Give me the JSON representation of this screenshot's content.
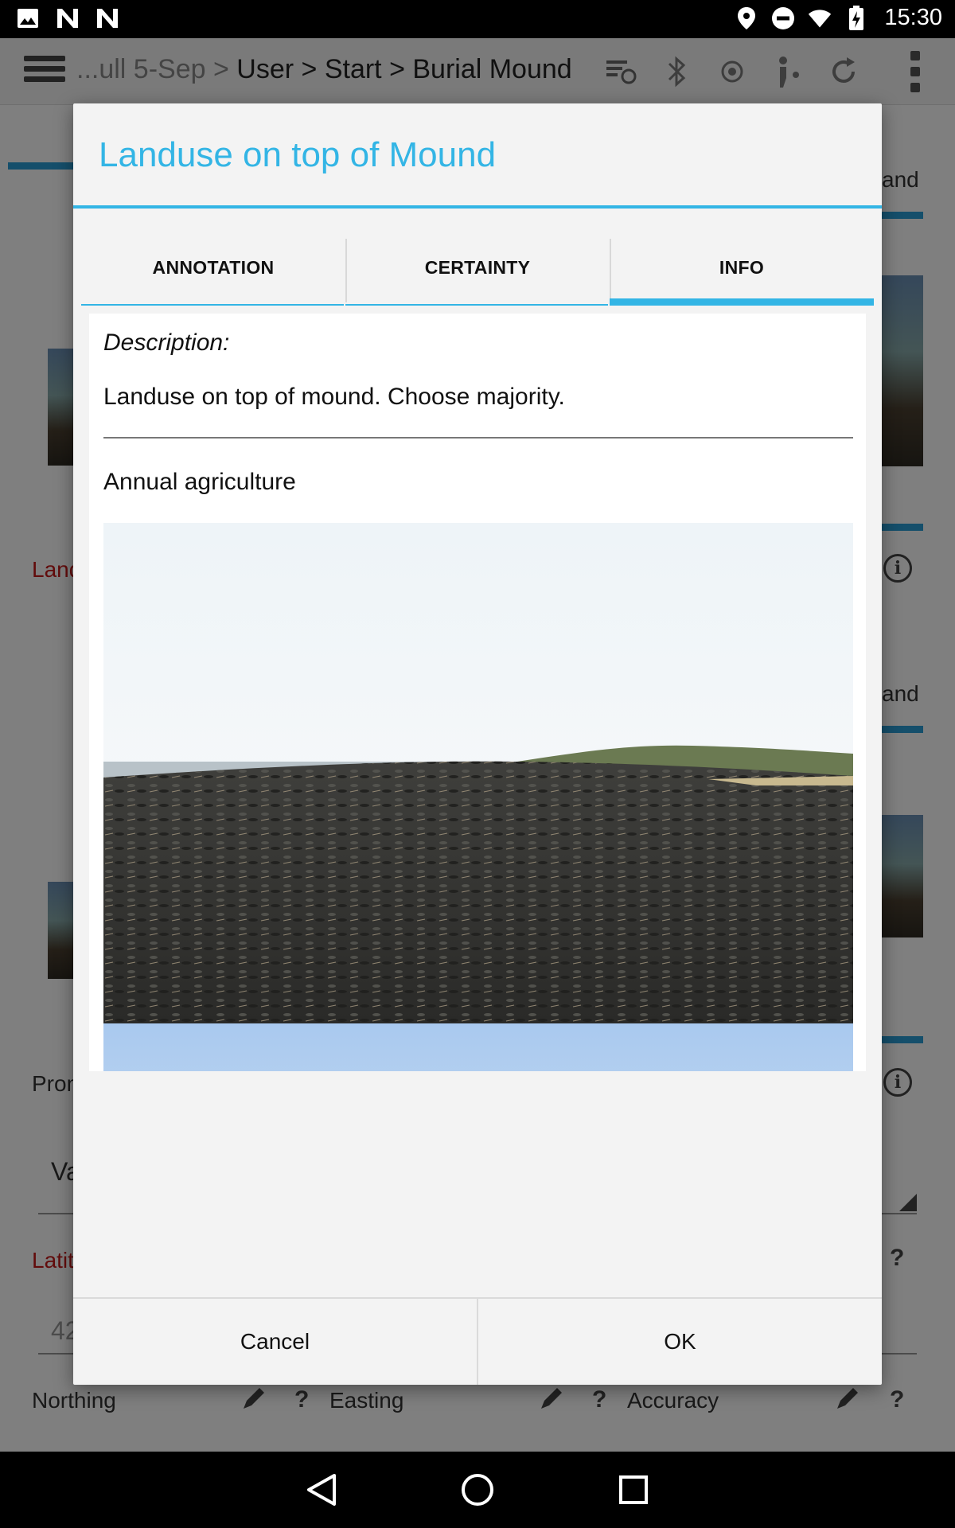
{
  "status_bar": {
    "time": "15:30",
    "icons": [
      "gallery-icon",
      "notification-n-icon",
      "notification-n-icon",
      "location-icon",
      "do-not-disturb-icon",
      "wifi-icon",
      "battery-charging-icon"
    ]
  },
  "app_bar": {
    "breadcrumb_dim": "...ull 5-Sep > ",
    "breadcrumb": "User > Start > Burial Mound",
    "actions": [
      "sync-icon",
      "bluetooth-icon",
      "gps-icon",
      "tracking-icon",
      "refresh-icon",
      "overflow-menu-icon"
    ]
  },
  "background": {
    "tab_label_1": "and",
    "tab_label_2": "and",
    "field_landuse_label": "Land",
    "field_prominence_label": "Prom",
    "field_value_text": "Va",
    "field_latitude_label": "Latit",
    "field_latitude_value": "42",
    "field_northing_label": "Northing",
    "field_easting_label": "Easting",
    "field_accuracy_label": "Accuracy",
    "help_mark": "?"
  },
  "dialog": {
    "title": "Landuse on top of Mound",
    "tabs": [
      {
        "label": "ANNOTATION",
        "active": false
      },
      {
        "label": "CERTAINTY",
        "active": false
      },
      {
        "label": "INFO",
        "active": true
      }
    ],
    "description_label": "Description:",
    "description_text": "Landuse on top of mound. Choose majority.",
    "option_label": "Annual agriculture",
    "buttons": {
      "cancel": "Cancel",
      "ok": "OK"
    }
  },
  "colors": {
    "accent": "#33b5e5",
    "required_label": "#c41818",
    "status_bar": "#000000",
    "nav_bar": "#000000"
  },
  "nav_bar": {
    "buttons": [
      "back-icon",
      "home-icon",
      "recents-icon"
    ]
  }
}
